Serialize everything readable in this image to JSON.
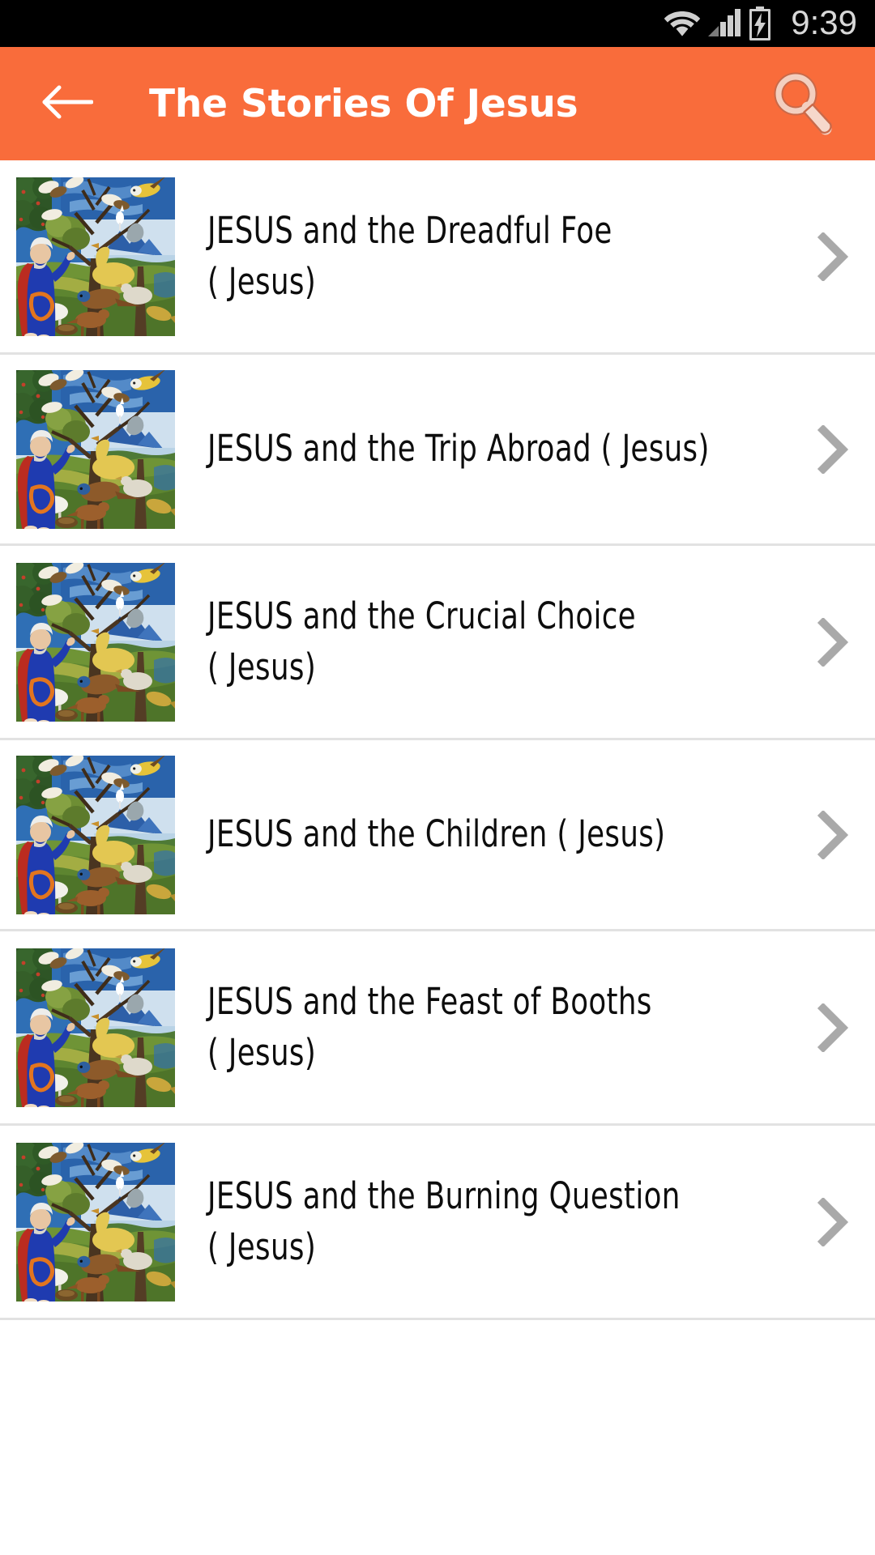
{
  "status_bar": {
    "time": "9:39",
    "icons": [
      "wifi-icon",
      "cellular-signal-icon",
      "battery-charging-icon"
    ]
  },
  "app_bar": {
    "back_label": "←",
    "title": "The Stories Of Jesus",
    "back_icon": "arrow-left-icon",
    "search_icon": "search-icon",
    "background_color": "#f96c3b",
    "title_color": "#ffffff"
  },
  "list": {
    "chevron_icon": "chevron-right-icon",
    "thumbnail_alt": "medieval-illumination-thumbnail",
    "items": [
      {
        "title": "JESUS and the Dreadful Foe\n( Jesus)"
      },
      {
        "title": "JESUS and the Trip Abroad ( Jesus)"
      },
      {
        "title": "JESUS and the Crucial Choice\n( Jesus)"
      },
      {
        "title": "JESUS and the Children ( Jesus)"
      },
      {
        "title": "JESUS and the Feast of Booths\n( Jesus)"
      },
      {
        "title": "JESUS and the Burning Question\n( Jesus)"
      }
    ]
  }
}
